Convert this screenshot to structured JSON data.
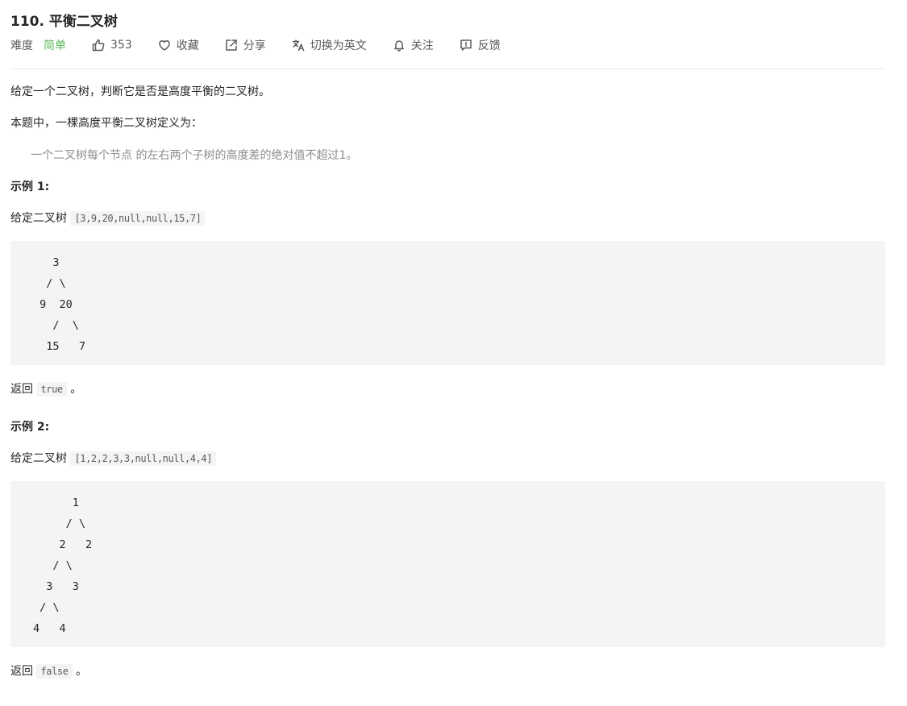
{
  "problem": {
    "title": "110. 平衡二叉树",
    "difficulty_label": "难度",
    "difficulty_value": "简单",
    "likes": "353",
    "favorite_label": "收藏",
    "share_label": "分享",
    "translate_label": "切换为英文",
    "follow_label": "关注",
    "feedback_label": "反馈"
  },
  "content": {
    "intro": "给定一个二叉树，判断它是否是高度平衡的二叉树。",
    "definition_intro": "本题中，一棵高度平衡二叉树定义为：",
    "definition_quote": "一个二叉树每个节点 的左右两个子树的高度差的绝对值不超过1。",
    "example1": {
      "heading": "示例 1:",
      "given_prefix": "给定二叉树 ",
      "given_value": "[3,9,20,null,null,15,7]",
      "tree": "   3\n  / \\\n 9  20\n   /  \\\n  15   7",
      "return_prefix": "返回 ",
      "return_value": "true",
      "return_suffix": " 。"
    },
    "example2": {
      "heading": "示例 2:",
      "given_prefix": "给定二叉树 ",
      "given_value": "[1,2,2,3,3,null,null,4,4]",
      "tree": "      1\n     / \\\n    2   2\n   / \\\n  3   3\n / \\\n4   4",
      "return_prefix": "返回 ",
      "return_value": "false",
      "return_suffix": " 。"
    }
  },
  "icons": {
    "like": "thumbs-up-icon",
    "favorite": "heart-icon",
    "share": "share-icon",
    "translate": "translate-icon",
    "follow": "bell-icon",
    "feedback": "feedback-icon"
  },
  "colors": {
    "easy": "#5cb85c",
    "code_bg": "#f4f4f4",
    "text": "#262626",
    "muted": "#8c8c8c"
  }
}
